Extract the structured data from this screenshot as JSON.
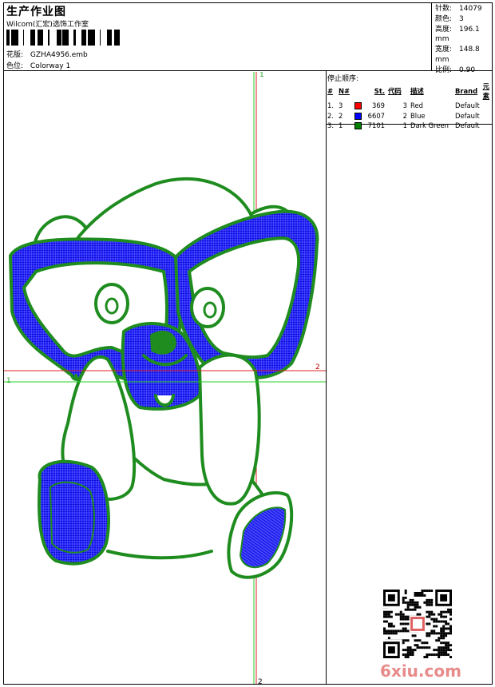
{
  "header": {
    "title": "生产作业图",
    "company": "Wilcom(汇宏)选饰工作室",
    "design_label": "花版:",
    "design_value": "GZHA4956.emb",
    "colorway_label": "色位:",
    "colorway_value": "Colorway 1"
  },
  "stats": [
    {
      "label": "针数:",
      "value": "14079"
    },
    {
      "label": "颜色:",
      "value": "3"
    },
    {
      "label": "高度:",
      "value": "196.1 mm"
    },
    {
      "label": "宽度:",
      "value": "148.8 mm"
    },
    {
      "label": "比例:",
      "value": "0.90"
    }
  ],
  "stop_sequence": {
    "title": "停止顺序:",
    "headers": [
      "#",
      "N#",
      "St.",
      "代码",
      "描述",
      "Brand",
      "元素"
    ],
    "rows": [
      {
        "idx": "1.",
        "n": "3",
        "color": "#ff0000",
        "st": "369",
        "code": "3",
        "desc": "Red",
        "brand": "Default"
      },
      {
        "idx": "2.",
        "n": "2",
        "color": "#0000ff",
        "st": "6607",
        "code": "2",
        "desc": "Blue",
        "brand": "Default"
      },
      {
        "idx": "3.",
        "n": "1",
        "color": "#008000",
        "st": "7101",
        "code": "1",
        "desc": "Dark Green",
        "brand": "Default"
      }
    ]
  },
  "markers": {
    "top": "1",
    "bottom": "2",
    "left": "1",
    "right": "2"
  },
  "colors": {
    "red": "#ff0000",
    "blue": "#1a1aff",
    "green": "#1e8c1e",
    "guide_green": "#20d020",
    "guide_red": "#e02020"
  },
  "watermark": "6xiu.com"
}
